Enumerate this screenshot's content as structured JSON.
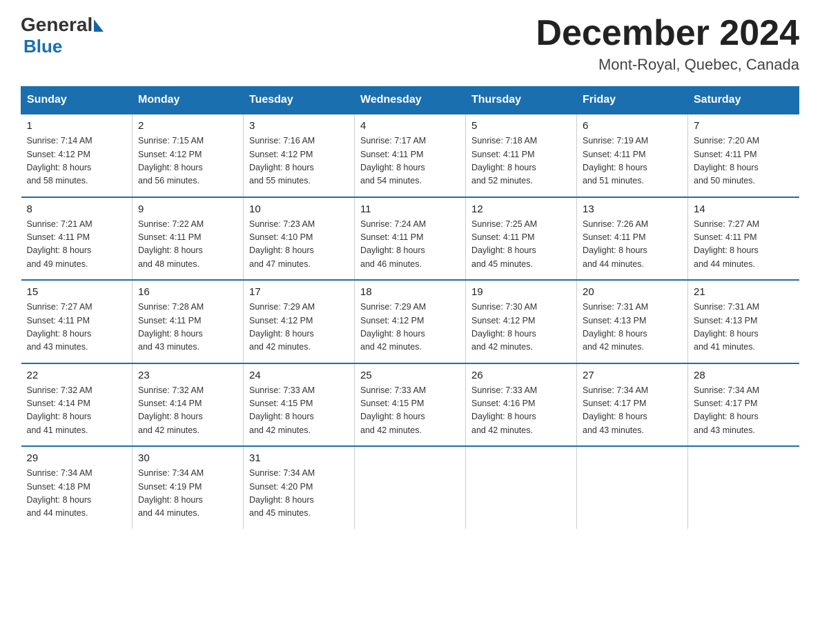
{
  "header": {
    "logo_general": "General",
    "logo_blue": "Blue",
    "title": "December 2024",
    "subtitle": "Mont-Royal, Quebec, Canada"
  },
  "days_of_week": [
    "Sunday",
    "Monday",
    "Tuesday",
    "Wednesday",
    "Thursday",
    "Friday",
    "Saturday"
  ],
  "weeks": [
    [
      {
        "day": "1",
        "sunrise": "7:14 AM",
        "sunset": "4:12 PM",
        "daylight": "8 hours and 58 minutes."
      },
      {
        "day": "2",
        "sunrise": "7:15 AM",
        "sunset": "4:12 PM",
        "daylight": "8 hours and 56 minutes."
      },
      {
        "day": "3",
        "sunrise": "7:16 AM",
        "sunset": "4:12 PM",
        "daylight": "8 hours and 55 minutes."
      },
      {
        "day": "4",
        "sunrise": "7:17 AM",
        "sunset": "4:11 PM",
        "daylight": "8 hours and 54 minutes."
      },
      {
        "day": "5",
        "sunrise": "7:18 AM",
        "sunset": "4:11 PM",
        "daylight": "8 hours and 52 minutes."
      },
      {
        "day": "6",
        "sunrise": "7:19 AM",
        "sunset": "4:11 PM",
        "daylight": "8 hours and 51 minutes."
      },
      {
        "day": "7",
        "sunrise": "7:20 AM",
        "sunset": "4:11 PM",
        "daylight": "8 hours and 50 minutes."
      }
    ],
    [
      {
        "day": "8",
        "sunrise": "7:21 AM",
        "sunset": "4:11 PM",
        "daylight": "8 hours and 49 minutes."
      },
      {
        "day": "9",
        "sunrise": "7:22 AM",
        "sunset": "4:11 PM",
        "daylight": "8 hours and 48 minutes."
      },
      {
        "day": "10",
        "sunrise": "7:23 AM",
        "sunset": "4:10 PM",
        "daylight": "8 hours and 47 minutes."
      },
      {
        "day": "11",
        "sunrise": "7:24 AM",
        "sunset": "4:11 PM",
        "daylight": "8 hours and 46 minutes."
      },
      {
        "day": "12",
        "sunrise": "7:25 AM",
        "sunset": "4:11 PM",
        "daylight": "8 hours and 45 minutes."
      },
      {
        "day": "13",
        "sunrise": "7:26 AM",
        "sunset": "4:11 PM",
        "daylight": "8 hours and 44 minutes."
      },
      {
        "day": "14",
        "sunrise": "7:27 AM",
        "sunset": "4:11 PM",
        "daylight": "8 hours and 44 minutes."
      }
    ],
    [
      {
        "day": "15",
        "sunrise": "7:27 AM",
        "sunset": "4:11 PM",
        "daylight": "8 hours and 43 minutes."
      },
      {
        "day": "16",
        "sunrise": "7:28 AM",
        "sunset": "4:11 PM",
        "daylight": "8 hours and 43 minutes."
      },
      {
        "day": "17",
        "sunrise": "7:29 AM",
        "sunset": "4:12 PM",
        "daylight": "8 hours and 42 minutes."
      },
      {
        "day": "18",
        "sunrise": "7:29 AM",
        "sunset": "4:12 PM",
        "daylight": "8 hours and 42 minutes."
      },
      {
        "day": "19",
        "sunrise": "7:30 AM",
        "sunset": "4:12 PM",
        "daylight": "8 hours and 42 minutes."
      },
      {
        "day": "20",
        "sunrise": "7:31 AM",
        "sunset": "4:13 PM",
        "daylight": "8 hours and 42 minutes."
      },
      {
        "day": "21",
        "sunrise": "7:31 AM",
        "sunset": "4:13 PM",
        "daylight": "8 hours and 41 minutes."
      }
    ],
    [
      {
        "day": "22",
        "sunrise": "7:32 AM",
        "sunset": "4:14 PM",
        "daylight": "8 hours and 41 minutes."
      },
      {
        "day": "23",
        "sunrise": "7:32 AM",
        "sunset": "4:14 PM",
        "daylight": "8 hours and 42 minutes."
      },
      {
        "day": "24",
        "sunrise": "7:33 AM",
        "sunset": "4:15 PM",
        "daylight": "8 hours and 42 minutes."
      },
      {
        "day": "25",
        "sunrise": "7:33 AM",
        "sunset": "4:15 PM",
        "daylight": "8 hours and 42 minutes."
      },
      {
        "day": "26",
        "sunrise": "7:33 AM",
        "sunset": "4:16 PM",
        "daylight": "8 hours and 42 minutes."
      },
      {
        "day": "27",
        "sunrise": "7:34 AM",
        "sunset": "4:17 PM",
        "daylight": "8 hours and 43 minutes."
      },
      {
        "day": "28",
        "sunrise": "7:34 AM",
        "sunset": "4:17 PM",
        "daylight": "8 hours and 43 minutes."
      }
    ],
    [
      {
        "day": "29",
        "sunrise": "7:34 AM",
        "sunset": "4:18 PM",
        "daylight": "8 hours and 44 minutes."
      },
      {
        "day": "30",
        "sunrise": "7:34 AM",
        "sunset": "4:19 PM",
        "daylight": "8 hours and 44 minutes."
      },
      {
        "day": "31",
        "sunrise": "7:34 AM",
        "sunset": "4:20 PM",
        "daylight": "8 hours and 45 minutes."
      },
      null,
      null,
      null,
      null
    ]
  ],
  "labels": {
    "sunrise": "Sunrise:",
    "sunset": "Sunset:",
    "daylight": "Daylight:"
  }
}
